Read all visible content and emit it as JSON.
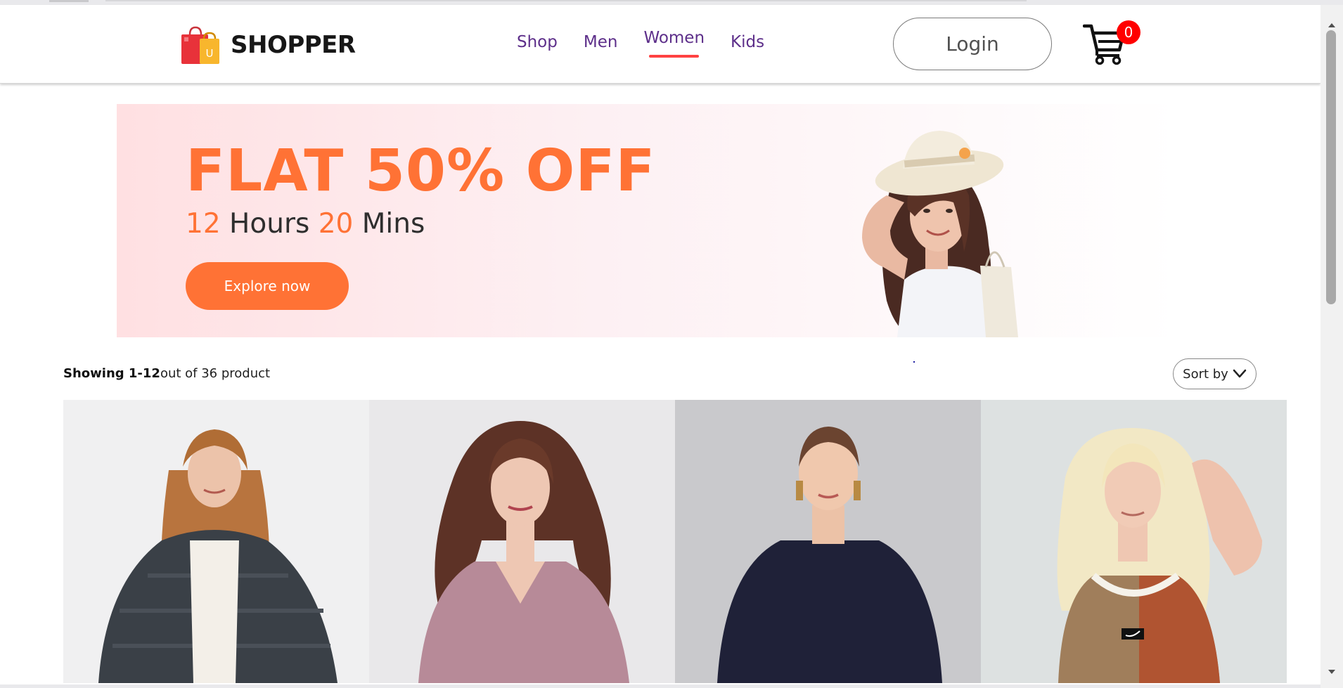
{
  "brand": {
    "name": "SHOPPER"
  },
  "nav": {
    "items": [
      {
        "label": "Shop"
      },
      {
        "label": "Men"
      },
      {
        "label": "Women"
      },
      {
        "label": "Kids"
      }
    ],
    "active": "Women"
  },
  "header": {
    "login_label": "Login",
    "cart_count": "0"
  },
  "hero": {
    "title": "FLAT 50% OFF",
    "hours_num": "12",
    "hours_label": "Hours",
    "mins_num": "20",
    "mins_label": "Mins",
    "cta_label": "Explore now"
  },
  "toolbar": {
    "showing_bold": "Showing 1-12",
    "showing_rest": "out of 36 product",
    "sort_label": "Sort by"
  },
  "products": [
    {
      "icon": "model-fur-jacket"
    },
    {
      "icon": "model-pink-blouse"
    },
    {
      "icon": "model-navy-sweater"
    },
    {
      "icon": "model-tank-top"
    }
  ],
  "colors": {
    "accent_orange": "#ff7235",
    "nav_purple": "#5d2f8a",
    "active_underline": "#ff4141",
    "badge_red": "#ff0000"
  }
}
